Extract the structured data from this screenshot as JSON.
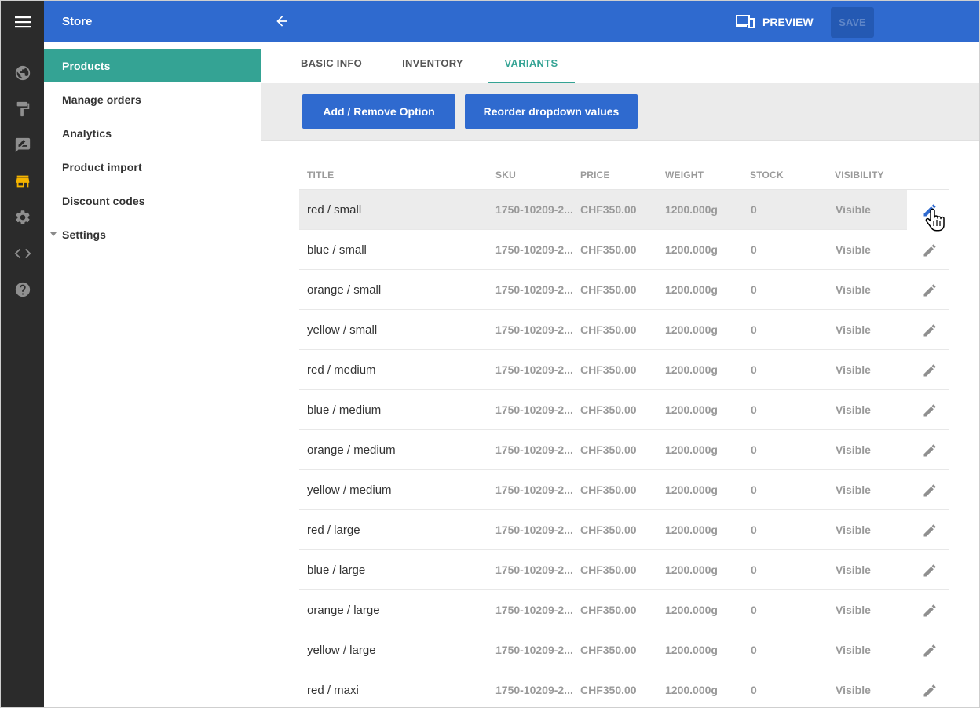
{
  "app": {
    "title": "Store"
  },
  "rail": {
    "items": [
      {
        "icon": "globe-icon"
      },
      {
        "icon": "paint-roller-icon"
      },
      {
        "icon": "rate-review-icon"
      },
      {
        "icon": "store-icon",
        "active": true
      },
      {
        "icon": "gear-icon"
      },
      {
        "icon": "code-icon"
      },
      {
        "icon": "help-icon"
      }
    ]
  },
  "sidebar": {
    "items": [
      {
        "label": "Products",
        "active": true
      },
      {
        "label": "Manage orders"
      },
      {
        "label": "Analytics"
      },
      {
        "label": "Product import"
      },
      {
        "label": "Discount codes"
      },
      {
        "label": "Settings",
        "expandable": true
      }
    ]
  },
  "header": {
    "preview_label": "PREVIEW",
    "save_label": "SAVE"
  },
  "tabs": [
    {
      "label": "BASIC INFO"
    },
    {
      "label": "INVENTORY"
    },
    {
      "label": "VARIANTS",
      "active": true
    }
  ],
  "toolbar": {
    "add_remove_label": "Add / Remove Option",
    "reorder_label": "Reorder dropdown values"
  },
  "table": {
    "columns": [
      "TITLE",
      "SKU",
      "PRICE",
      "WEIGHT",
      "STOCK",
      "VISIBILITY"
    ],
    "rows": [
      {
        "title": "red / small",
        "sku": "1750-10209-2...",
        "price": "CHF350.00",
        "weight": "1200.000g",
        "stock": "0",
        "visibility": "Visible"
      },
      {
        "title": "blue / small",
        "sku": "1750-10209-2...",
        "price": "CHF350.00",
        "weight": "1200.000g",
        "stock": "0",
        "visibility": "Visible"
      },
      {
        "title": "orange / small",
        "sku": "1750-10209-2...",
        "price": "CHF350.00",
        "weight": "1200.000g",
        "stock": "0",
        "visibility": "Visible"
      },
      {
        "title": "yellow / small",
        "sku": "1750-10209-2...",
        "price": "CHF350.00",
        "weight": "1200.000g",
        "stock": "0",
        "visibility": "Visible"
      },
      {
        "title": "red / medium",
        "sku": "1750-10209-2...",
        "price": "CHF350.00",
        "weight": "1200.000g",
        "stock": "0",
        "visibility": "Visible"
      },
      {
        "title": "blue / medium",
        "sku": "1750-10209-2...",
        "price": "CHF350.00",
        "weight": "1200.000g",
        "stock": "0",
        "visibility": "Visible"
      },
      {
        "title": "orange / medium",
        "sku": "1750-10209-2...",
        "price": "CHF350.00",
        "weight": "1200.000g",
        "stock": "0",
        "visibility": "Visible"
      },
      {
        "title": "yellow / medium",
        "sku": "1750-10209-2...",
        "price": "CHF350.00",
        "weight": "1200.000g",
        "stock": "0",
        "visibility": "Visible"
      },
      {
        "title": "red / large",
        "sku": "1750-10209-2...",
        "price": "CHF350.00",
        "weight": "1200.000g",
        "stock": "0",
        "visibility": "Visible"
      },
      {
        "title": "blue / large",
        "sku": "1750-10209-2...",
        "price": "CHF350.00",
        "weight": "1200.000g",
        "stock": "0",
        "visibility": "Visible"
      },
      {
        "title": "orange / large",
        "sku": "1750-10209-2...",
        "price": "CHF350.00",
        "weight": "1200.000g",
        "stock": "0",
        "visibility": "Visible"
      },
      {
        "title": "yellow / large",
        "sku": "1750-10209-2...",
        "price": "CHF350.00",
        "weight": "1200.000g",
        "stock": "0",
        "visibility": "Visible"
      },
      {
        "title": "red / maxi",
        "sku": "1750-10209-2...",
        "price": "CHF350.00",
        "weight": "1200.000g",
        "stock": "0",
        "visibility": "Visible"
      }
    ]
  },
  "colors": {
    "brand_blue": "#2f6acf",
    "teal_accent": "#34a394",
    "rail_bg": "#2b2b2b",
    "active_rail_icon": "#f5b400"
  }
}
